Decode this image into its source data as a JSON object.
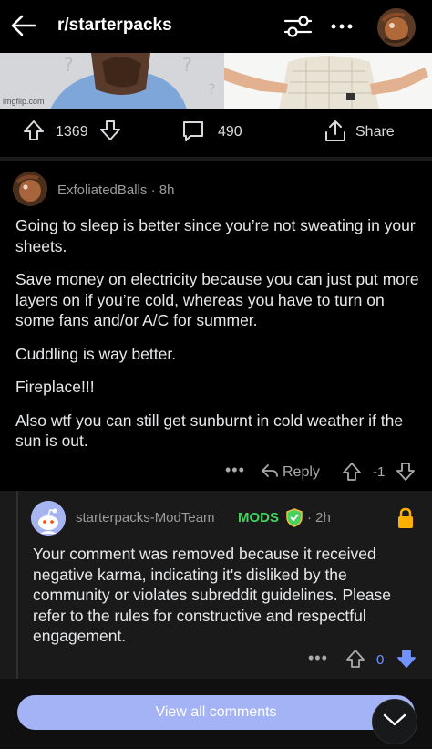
{
  "header": {
    "subreddit": "r/starterpacks",
    "icons": [
      "back-arrow-icon",
      "filter-icon",
      "more-icon",
      "user-avatar"
    ]
  },
  "post_image": {
    "watermark": "imgflip.com"
  },
  "post_actions": {
    "score": "1369",
    "comments": "490",
    "share_label": "Share"
  },
  "comment": {
    "author": "ExfoliatedBalls",
    "age": "· 8h",
    "paragraphs": [
      "Going to sleep is better since you’re not sweating in your sheets.",
      "Save money on electricity because you can just put more layers on if you’re cold, whereas you have to turn on some fans and/or A/C for summer.",
      "Cuddling is way better.",
      "Fireplace!!!",
      "Also wtf you can still get sunburnt in cold weather if the sun is out."
    ],
    "more_label": "•••",
    "reply_label": "Reply",
    "score": "-1"
  },
  "mod_reply": {
    "author": "starterpacks-ModTeam",
    "badge": "MODS",
    "age": "· 2h",
    "body": "Your comment was removed because it received negative karma, indicating it's disliked by the community or violates subreddit guidelines. Please refer to the rules for constructive and respectful engagement.",
    "more_label": "•••",
    "score": "0"
  },
  "footer": {
    "view_all_label": "View all comments"
  },
  "colors": {
    "background": "#000000",
    "mod_green": "#46d160",
    "downvote_blue": "#7193ff",
    "lock_orange": "#ffb000",
    "view_all_button": "#a3b3f5"
  }
}
